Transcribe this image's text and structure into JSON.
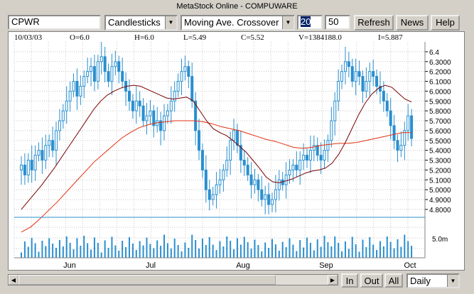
{
  "window": {
    "title": "MetaStock Online - COMPUWARE"
  },
  "toolbar": {
    "symbol": "CPWR",
    "chart_type": "Candlesticks",
    "indicator": "Moving Ave. Crossover",
    "period_fast": "20",
    "period_slow": "50",
    "refresh_label": "Refresh",
    "news_label": "News",
    "help_label": "Help"
  },
  "info_bar": {
    "date": "10/03/03",
    "open": "O=6.0",
    "high": "H=6.0",
    "low": "L=5.49",
    "close": "C=5.52",
    "volume": "V=1384188.0",
    "indicator_value": "I=5.887"
  },
  "bottom": {
    "in_label": "In",
    "out_label": "Out",
    "all_label": "All",
    "period": "Daily"
  },
  "colors": {
    "candle": "#2a8fcf",
    "ma_fast": "#7a0000",
    "ma_slow": "#e03010",
    "volume": "#2a8fcf"
  },
  "chart_data": {
    "type": "candlestick",
    "x_tick_labels": [
      "Jun",
      "Jul",
      "Aug",
      "Sep",
      "Oct"
    ],
    "y_tick_labels": [
      "6.4",
      "6.3000",
      "6.2000",
      "6.1000",
      "6.0000",
      "5.9000",
      "5.8000",
      "5.7000",
      "5.6000",
      "5.5000",
      "5.4000",
      "5.3000",
      "5.2000",
      "5.1000",
      "5.0000",
      "4.9000",
      "4.8000"
    ],
    "volume_tick_label": "5.0m",
    "ylim": [
      4.72,
      6.5
    ],
    "grid": true,
    "series": [
      {
        "name": "Candlesticks",
        "values": [
          5.25,
          5.15,
          5.3,
          5.2,
          5.35,
          5.4,
          5.3,
          5.45,
          5.5,
          5.4,
          5.6,
          5.7,
          5.8,
          5.9,
          6.0,
          6.1,
          5.95,
          6.05,
          6.15,
          6.2,
          6.25,
          6.1,
          6.3,
          6.35,
          6.2,
          6.1,
          6.25,
          6.3,
          6.2,
          6.1,
          6.0,
          5.9,
          5.8,
          5.9,
          5.85,
          5.7,
          5.75,
          5.8,
          5.65,
          5.7,
          5.6,
          5.75,
          5.8,
          5.9,
          6.0,
          6.1,
          6.2,
          6.25,
          6.15,
          5.9,
          5.6,
          5.4,
          5.2,
          5.0,
          4.9,
          4.95,
          5.05,
          5.1,
          5.2,
          5.3,
          5.5,
          5.6,
          5.45,
          5.3,
          5.25,
          5.15,
          5.05,
          5.1,
          5.0,
          4.9,
          4.95,
          4.85,
          4.9,
          5.0,
          5.1,
          5.05,
          5.15,
          5.2,
          5.25,
          5.2,
          5.3,
          5.35,
          5.3,
          5.4,
          5.45,
          5.35,
          5.3,
          5.4,
          5.5,
          5.7,
          5.9,
          6.1,
          6.2,
          6.3,
          6.25,
          6.1,
          6.2,
          6.15,
          6.0,
          6.1,
          6.2,
          6.15,
          6.05,
          6.0,
          5.9,
          5.8,
          5.65,
          5.5,
          5.4,
          5.45,
          5.6,
          5.75,
          5.52
        ]
      },
      {
        "name": "MA 20",
        "values": [
          4.8,
          4.88,
          4.96,
          5.04,
          5.13,
          5.22,
          5.32,
          5.42,
          5.52,
          5.62,
          5.72,
          5.82,
          5.9,
          5.96,
          6.0,
          6.03,
          6.05,
          6.06,
          6.05,
          6.02,
          5.99,
          5.96,
          5.93,
          5.92,
          5.93,
          5.94,
          5.9,
          5.8,
          5.7,
          5.62,
          5.58,
          5.55,
          5.5,
          5.44,
          5.38,
          5.3,
          5.22,
          5.13,
          5.08,
          5.07,
          5.09,
          5.11,
          5.14,
          5.17,
          5.19,
          5.2,
          5.22,
          5.27,
          5.36,
          5.48,
          5.62,
          5.76,
          5.88,
          5.97,
          6.03,
          6.06,
          6.04,
          5.98,
          5.92,
          5.89
        ]
      },
      {
        "name": "MA 50",
        "values": [
          4.57,
          4.62,
          4.7,
          4.79,
          4.88,
          4.98,
          5.08,
          5.18,
          5.28,
          5.36,
          5.44,
          5.52,
          5.58,
          5.63,
          5.66,
          5.68,
          5.69,
          5.7,
          5.7,
          5.7,
          5.69,
          5.67,
          5.64,
          5.62,
          5.6,
          5.57,
          5.54,
          5.51,
          5.49,
          5.46,
          5.43,
          5.42,
          5.43,
          5.45,
          5.46,
          5.47,
          5.47,
          5.48,
          5.5,
          5.52,
          5.54,
          5.56,
          5.58,
          5.58
        ]
      }
    ]
  }
}
